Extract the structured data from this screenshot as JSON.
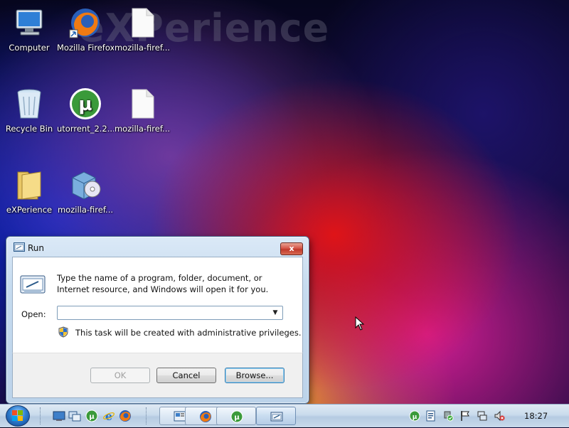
{
  "desktop": {
    "watermark": "eXPerience",
    "icons": [
      {
        "label": "Computer",
        "icon": "computer-icon"
      },
      {
        "label": "Mozilla Firefox",
        "icon": "firefox-icon"
      },
      {
        "label": "mozilla-firef...",
        "icon": "file-icon"
      },
      {
        "label": "Recycle Bin",
        "icon": "recycle-bin-icon"
      },
      {
        "label": "utorrent_2.2....",
        "icon": "utorrent-icon"
      },
      {
        "label": "mozilla-firef...",
        "icon": "file-icon"
      },
      {
        "label": "eXPerience",
        "icon": "folder-icon"
      },
      {
        "label": "mozilla-firef...",
        "icon": "installer-icon"
      }
    ]
  },
  "run_dialog": {
    "title": "Run",
    "close_label": "x",
    "description": "Type the name of a program, folder, document, or Internet resource, and Windows will open it for you.",
    "open_label": "Open:",
    "open_value": "",
    "admin_note": "This task will be created with administrative privileges.",
    "buttons": {
      "ok": "OK",
      "cancel": "Cancel",
      "browse": "Browse..."
    }
  },
  "taskbar": {
    "clock": "18:27",
    "quick_launch": [
      "show-desktop-icon",
      "switch-windows-icon",
      "utorrent-icon",
      "internet-explorer-icon",
      "firefox-icon"
    ],
    "task_buttons": [
      "control-panel-icon",
      "firefox-icon",
      "utorrent-icon",
      "run-dialog-icon"
    ],
    "tray": [
      "utorrent-icon",
      "document-icon",
      "safely-remove-icon",
      "action-center-flag-icon",
      "network-icon",
      "volume-muted-icon"
    ]
  },
  "colors": {
    "taskbar": "#c9dbec",
    "dialog_frame": "#c6dbef",
    "close_button": "#c0392b",
    "utorrent_green": "#3a9a3a"
  }
}
